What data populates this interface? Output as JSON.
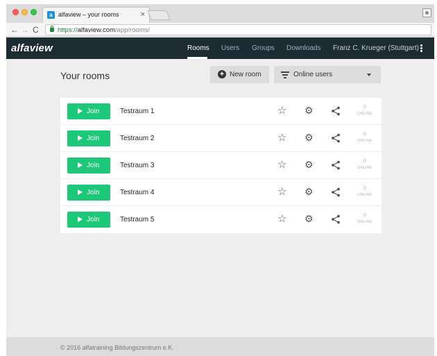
{
  "browser": {
    "tab_title": "alfaview – your rooms",
    "tab_close": "×",
    "favicon_letter": "a",
    "url": {
      "scheme": "https://",
      "host": "alfaview.com",
      "path": "/app/rooms/"
    },
    "icons": {
      "back": "arrow-left-icon",
      "forward": "arrow-right-icon",
      "reload": "reload-icon",
      "lock": "lock-icon",
      "profile": "person-icon"
    }
  },
  "header": {
    "logo": "alfaview",
    "nav": [
      {
        "label": "Rooms",
        "active": true
      },
      {
        "label": "Users",
        "active": false
      },
      {
        "label": "Groups",
        "active": false
      },
      {
        "label": "Downloads",
        "active": false
      }
    ],
    "user": "Franz C. Krueger (Stuttgart)",
    "colors": {
      "background": "#1d2b33",
      "active": "#ffffff",
      "inactive": "#9fb1bb"
    }
  },
  "main": {
    "title": "Your rooms",
    "new_room_label": "New room",
    "filter_label": "Online users",
    "rooms": [
      {
        "join_label": "Join",
        "name": "Testraum 1",
        "online_count": "0",
        "online_label": "ONLINE"
      },
      {
        "join_label": "Join",
        "name": "Testraum 2",
        "online_count": "0",
        "online_label": "ONLINE"
      },
      {
        "join_label": "Join",
        "name": "Testraum 3",
        "online_count": "0",
        "online_label": "ONLINE"
      },
      {
        "join_label": "Join",
        "name": "Testraum 4",
        "online_count": "0",
        "online_label": "ONLINE"
      },
      {
        "join_label": "Join",
        "name": "Testraum 5",
        "online_count": "0",
        "online_label": "ONLINE"
      }
    ],
    "colors": {
      "join": "#1ec879",
      "button_bg": "#dcdcdc"
    }
  },
  "footer": {
    "text": "© 2016 alfatraining Bildungszentrum e.K."
  }
}
